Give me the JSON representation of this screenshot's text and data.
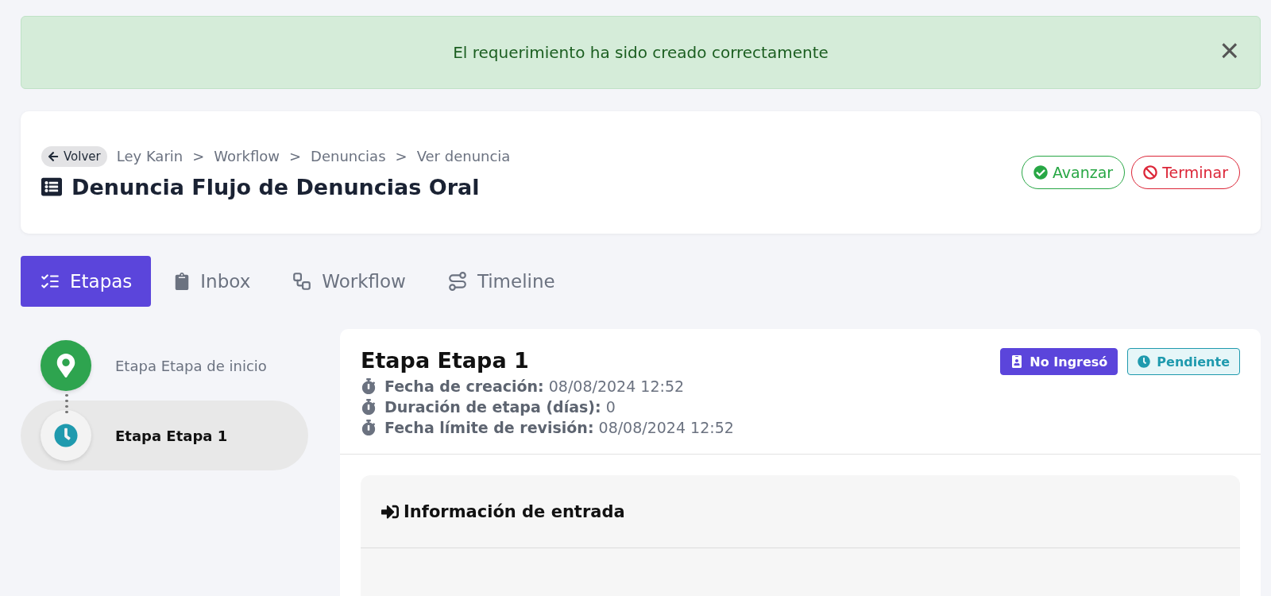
{
  "alert": {
    "message": "El requerimiento ha sido creado correctamente",
    "close": "×"
  },
  "header": {
    "back": "Volver",
    "breadcrumbs": [
      "Ley Karin",
      "Workflow",
      "Denuncias",
      "Ver denuncia"
    ],
    "separator": ">",
    "title": "Denuncia Flujo de Denuncias Oral",
    "actions": [
      {
        "kind": "advance",
        "label": "Avanzar"
      },
      {
        "kind": "terminate",
        "label": "Terminar"
      }
    ]
  },
  "tabs": [
    {
      "kind": "stages",
      "label": "Etapas",
      "selected": true
    },
    {
      "kind": "inbox",
      "label": "Inbox",
      "selected": false
    },
    {
      "kind": "workflow",
      "label": "Workflow",
      "selected": false
    },
    {
      "kind": "timeline",
      "label": "Timeline",
      "selected": false
    }
  ],
  "stages": [
    {
      "kind": "start",
      "label": "Etapa Etapa de inicio",
      "selected": false
    },
    {
      "kind": "pending",
      "label": "Etapa Etapa 1",
      "selected": true
    }
  ],
  "detail": {
    "title": "Etapa Etapa 1",
    "badges": [
      {
        "kind": "user",
        "label": "No Ingresó"
      },
      {
        "kind": "pending",
        "label": "Pendiente"
      }
    ],
    "meta": [
      "**Fecha de creación:** 08/08/2024 12:52",
      "**Duración de etapa (días):** 0",
      "**Fecha límite de revisión:** 08/08/2024 12:52"
    ],
    "section": {
      "title": "Información de entrada"
    }
  }
}
